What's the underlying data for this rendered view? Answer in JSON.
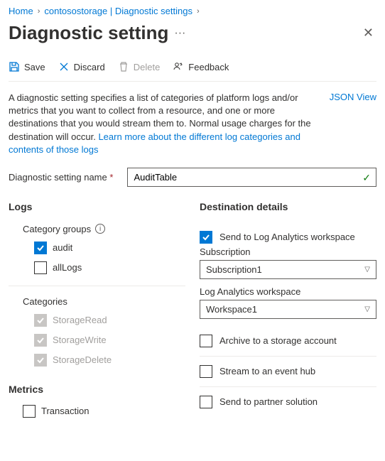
{
  "breadcrumb": {
    "home": "Home",
    "storage": "contosostorage | Diagnostic settings"
  },
  "title": "Diagnostic setting",
  "toolbar": {
    "save": "Save",
    "discard": "Discard",
    "delete": "Delete",
    "feedback": "Feedback"
  },
  "description": "A diagnostic setting specifies a list of categories of platform logs and/or metrics that you want to collect from a resource, and one or more destinations that you would stream them to. Normal usage charges for the destination will occur. ",
  "learn_more": "Learn more about the different log categories and contents of those logs",
  "json_view": "JSON View",
  "name_label": "Diagnostic setting name",
  "name_value": "AuditTable",
  "logs": {
    "heading": "Logs",
    "category_groups": "Category groups",
    "audit": "audit",
    "allLogs": "allLogs",
    "categories": "Categories",
    "storageRead": "StorageRead",
    "storageWrite": "StorageWrite",
    "storageDelete": "StorageDelete"
  },
  "metrics": {
    "heading": "Metrics",
    "transaction": "Transaction"
  },
  "dest": {
    "heading": "Destination details",
    "la": "Send to Log Analytics workspace",
    "sub_label": "Subscription",
    "sub_value": "Subscription1",
    "ws_label": "Log Analytics workspace",
    "ws_value": "Workspace1",
    "archive": "Archive to a storage account",
    "eventhub": "Stream to an event hub",
    "partner": "Send to partner solution"
  }
}
